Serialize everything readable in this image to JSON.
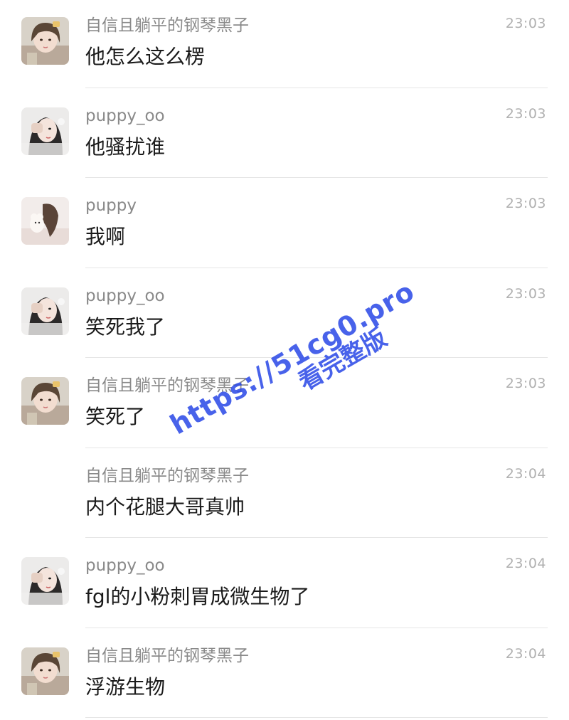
{
  "messages": [
    {
      "sender": "自信且躺平的钢琴黑子",
      "time": "23:03",
      "text": "他怎么这么楞",
      "avatar": "avatar-a"
    },
    {
      "sender": "puppy_oo",
      "time": "23:03",
      "text": "他骚扰谁",
      "avatar": "avatar-b"
    },
    {
      "sender": "puppy",
      "time": "23:03",
      "text": "我啊",
      "avatar": "avatar-c"
    },
    {
      "sender": "puppy_oo",
      "time": "23:03",
      "text": "笑死我了",
      "avatar": "avatar-b"
    },
    {
      "sender": "自信且躺平的钢琴黑子",
      "time": "23:03",
      "text": "笑死了",
      "avatar": "avatar-a"
    },
    {
      "sender": "自信且躺平的钢琴黑子",
      "time": "23:04",
      "text": "内个花腿大哥真帅",
      "avatar": "none"
    },
    {
      "sender": "puppy_oo",
      "time": "23:04",
      "text": "fgl的小粉刺胃成微生物了",
      "avatar": "avatar-b"
    },
    {
      "sender": "自信且躺平的钢琴黑子",
      "time": "23:04",
      "text": "浮游生物",
      "avatar": "avatar-a"
    }
  ],
  "watermark": {
    "line1": "https://51cg0.pro",
    "line2": "看完整版"
  },
  "colors": {
    "sender": "#8a8a8a",
    "time": "#b0b0b0",
    "text": "#1a1a1a",
    "divider": "#e6e6e6",
    "watermark": "#2846e6"
  }
}
